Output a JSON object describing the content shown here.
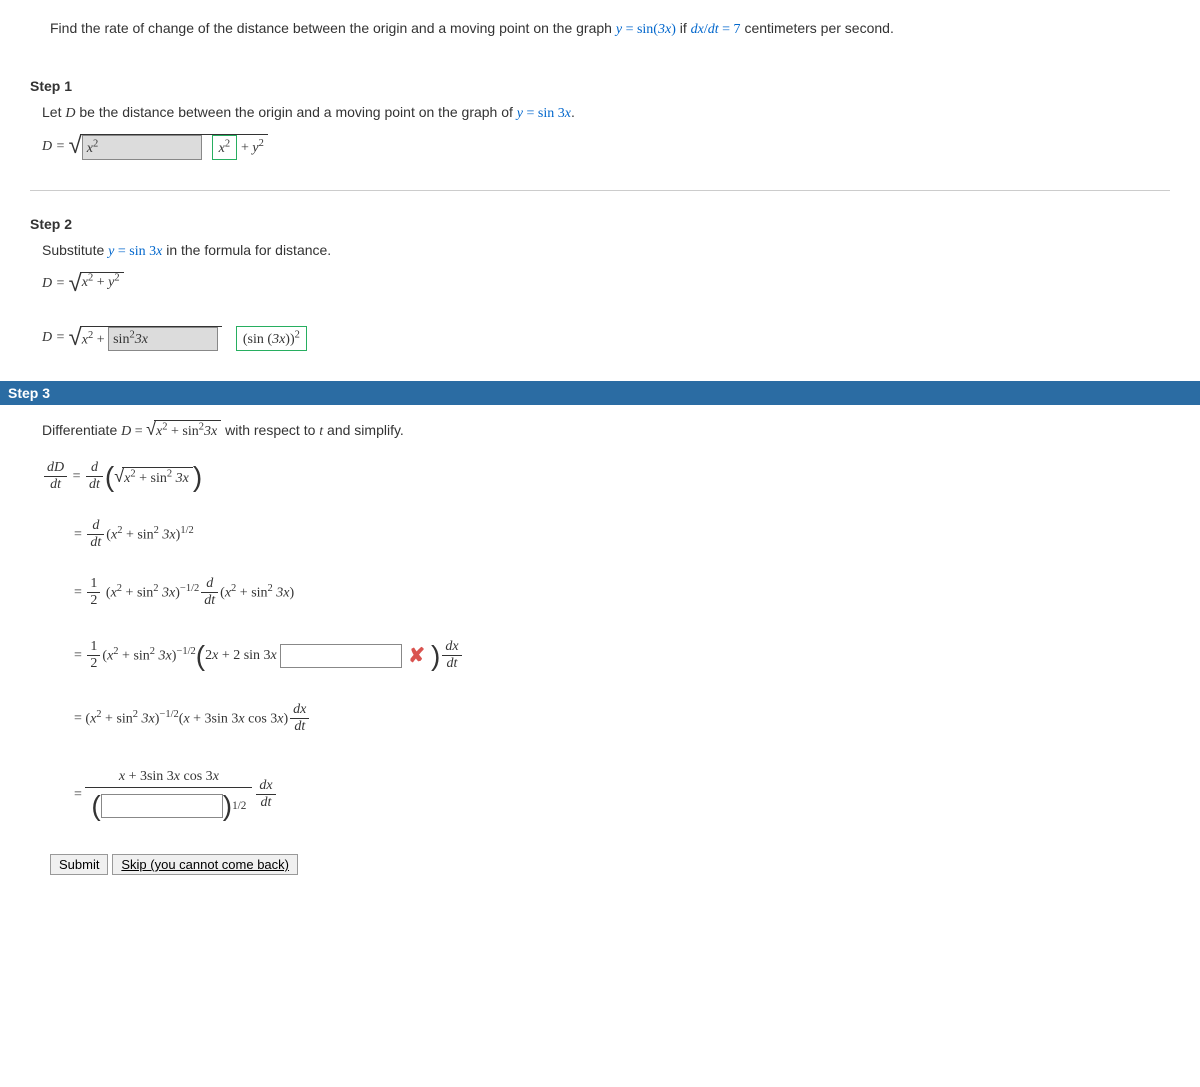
{
  "problem": {
    "prefix": "Find the rate of change of the distance between the origin and a moving point on the graph ",
    "equation": "y = sin(3x)",
    "middle": " if ",
    "rate": "dx/dt = 7",
    "suffix": " centimeters per second."
  },
  "step1": {
    "label": "Step 1",
    "text_prefix": "Let ",
    "text_D": "D",
    "text_middle": " be the distance between the origin and a moving point on the graph of ",
    "text_eq": "y = sin 3x",
    "text_period": ".",
    "D_eq": "D =",
    "input_value": "x²",
    "correct_value": "x²",
    "plus_y2": "+ y²"
  },
  "step2": {
    "label": "Step 2",
    "text_prefix": "Substitute ",
    "text_eq": "y = sin 3x",
    "text_suffix": " in the formula for distance.",
    "line1_lhs": "D =",
    "line1_rhs": "x² + y²",
    "line2_lhs": "D =",
    "line2_prefix": "x² +",
    "input_value": "sin²3x",
    "correct_value": "(sin (3x))²"
  },
  "step3": {
    "label": "Step 3",
    "text_prefix": "Differentiate ",
    "text_D": "D",
    "text_eq": " = ",
    "text_sqrt": "x² + sin²3x",
    "text_suffix": "  with respect to ",
    "text_t": "t",
    "text_end": " and simplify.",
    "line1_lhs_num": "dD",
    "line1_lhs_den": "dt",
    "line1_rhs_num": "d",
    "line1_rhs_den": "dt",
    "line1_sqrt": "x² + sin² 3x",
    "line2_expr": "(x² + sin² 3x)",
    "line2_exp": "1/2",
    "line3_half": "1",
    "line3_half_den": "2",
    "line3_base": "(x² + sin² 3x)",
    "line3_exp": "−1/2",
    "line3_inner": "(x² + sin² 3x)",
    "line4_base": "(x² + sin² 3x)",
    "line4_exp": "−1/2",
    "line4_inner_prefix": "2x + 2 sin 3x",
    "line4_dxdt_num": "dx",
    "line4_dxdt_den": "dt",
    "line5_base": "(x² + sin² 3x)",
    "line5_exp": "−1/2",
    "line5_rest": "(x + 3sin 3x cos 3x)",
    "line6_num": "x + 3sin 3x cos 3x",
    "line6_exp": "1/2",
    "line6_dxdt_num": "dx",
    "line6_dxdt_den": "dt"
  },
  "buttons": {
    "submit": "Submit",
    "skip": "Skip (you cannot come back)"
  }
}
